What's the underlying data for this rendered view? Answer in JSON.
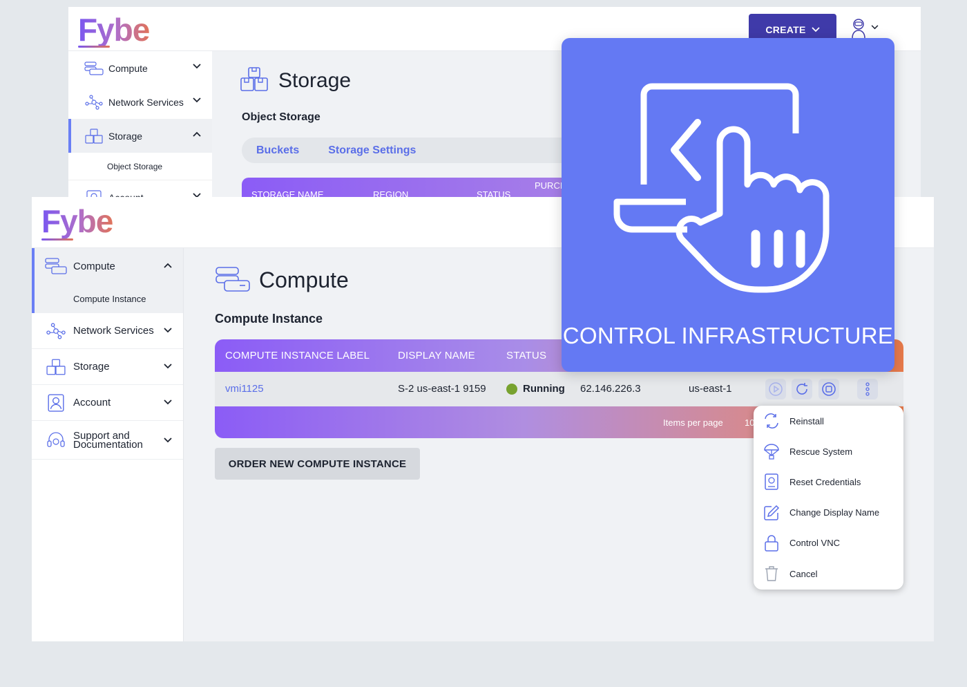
{
  "brand": {
    "logo_text": "Fybe"
  },
  "back_window": {
    "header": {
      "create_label": "CREATE"
    },
    "sidebar": {
      "items": [
        {
          "label": "Compute",
          "icon": "server-icon"
        },
        {
          "label": "Network Services",
          "icon": "network-icon"
        },
        {
          "label": "Storage",
          "icon": "boxes-icon",
          "active": true
        },
        {
          "label": "Account",
          "icon": "account-icon"
        }
      ],
      "sub_item": "Object Storage"
    },
    "page_title": "Storage",
    "section_title": "Object Storage",
    "tabs": [
      "Buckets",
      "Storage Settings"
    ],
    "table_headers": [
      "STORAGE NAME",
      "REGION",
      "STATUS",
      "PURCH"
    ]
  },
  "front_window": {
    "sidebar": {
      "items": [
        {
          "label": "Compute",
          "icon": "server-icon",
          "active": true
        },
        {
          "label": "Network Services",
          "icon": "network-icon"
        },
        {
          "label": "Storage",
          "icon": "boxes-icon"
        },
        {
          "label": "Account",
          "icon": "account-icon"
        },
        {
          "label": "Support and Documentation",
          "icon": "headset-icon"
        }
      ],
      "sub_item": "Compute Instance",
      "support_line1": "Support and",
      "support_line2": "Documentation"
    },
    "page_title": "Compute",
    "section_title": "Compute Instance",
    "table": {
      "headers": [
        "COMPUTE INSTANCE LABEL",
        "DISPLAY NAME",
        "STATUS"
      ],
      "row": {
        "label": "vmi1125",
        "display_name": "S-2 us-east-1 9159",
        "status": "Running",
        "ip": "62.146.226.3",
        "region": "us-east-1"
      },
      "footer": {
        "items_per_page_label": "Items per page",
        "per_page_value": "10"
      }
    },
    "order_button": "ORDER NEW COMPUTE INSTANCE"
  },
  "overlay": {
    "caption": "CONTROL INFRASTRUCTURE",
    "icon": "laptop-pointer-icon"
  },
  "context_menu": {
    "items": [
      {
        "label": "Reinstall",
        "icon": "reinstall-icon"
      },
      {
        "label": "Rescue System",
        "icon": "parachute-icon"
      },
      {
        "label": "Reset Credentials",
        "icon": "credentials-icon"
      },
      {
        "label": "Change Display Name",
        "icon": "edit-icon"
      },
      {
        "label": "Control VNC",
        "icon": "lock-icon"
      },
      {
        "label": "Cancel",
        "icon": "trash-icon"
      }
    ]
  },
  "colors": {
    "accent": "#6479f3",
    "brand_dark": "#3f3aa9",
    "status_running": "#78a22f",
    "link": "#5a6ee8"
  }
}
